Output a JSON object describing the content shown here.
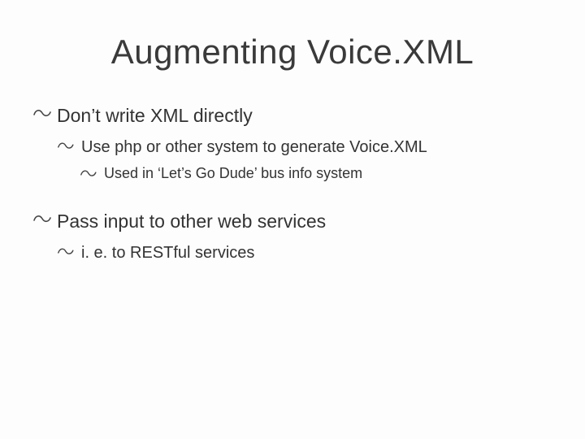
{
  "title": "Augmenting Voice.XML",
  "bullets": {
    "b1": "Don’t write  XML directly",
    "b2": "Use php or other system to generate Voice.XML",
    "b3": "Used in ‘Let’s Go Dude’ bus info system",
    "b4": "Pass input to other web services",
    "b5": "i. e. to RESTful services"
  }
}
